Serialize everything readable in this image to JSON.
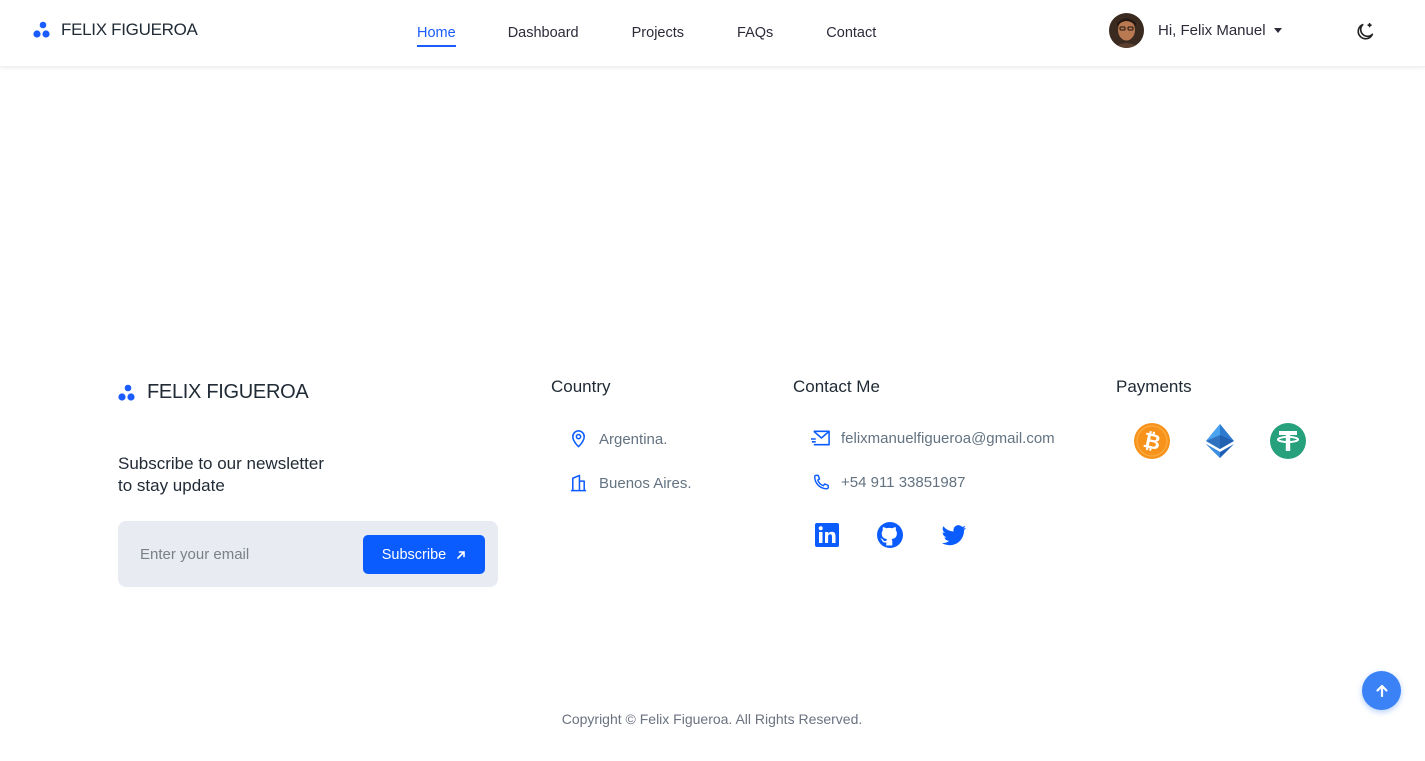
{
  "header": {
    "brand": "FELIX FIGUEROA",
    "nav": [
      {
        "label": "Home",
        "active": true
      },
      {
        "label": "Dashboard"
      },
      {
        "label": "Projects"
      },
      {
        "label": "FAQs"
      },
      {
        "label": "Contact"
      }
    ],
    "user_greeting": "Hi, Felix Manuel"
  },
  "footer": {
    "brand": "FELIX FIGUEROA",
    "newsletter_line1": "Subscribe to our newsletter",
    "newsletter_line2": "to stay update",
    "email_placeholder": "Enter your email",
    "subscribe_label": "Subscribe",
    "country_title": "Country",
    "country": "Argentina.",
    "city": "Buenos Aires.",
    "contact_title": "Contact Me",
    "email": "felixmanuelfigueroa@gmail.com",
    "phone": "+54 911 33851987",
    "social": [
      "linkedin-icon",
      "github-icon",
      "twitter-icon"
    ],
    "payments_title": "Payments",
    "payments": [
      "bitcoin-icon",
      "ethereum-icon",
      "tether-icon"
    ],
    "copyright": "Copyright © Felix Figueroa. All Rights Reserved."
  },
  "colors": {
    "accent": "#0b5cff",
    "subscribe_bg": "#e8ebf2",
    "bitcoin": "#f7931a",
    "tether": "#26a17b"
  }
}
